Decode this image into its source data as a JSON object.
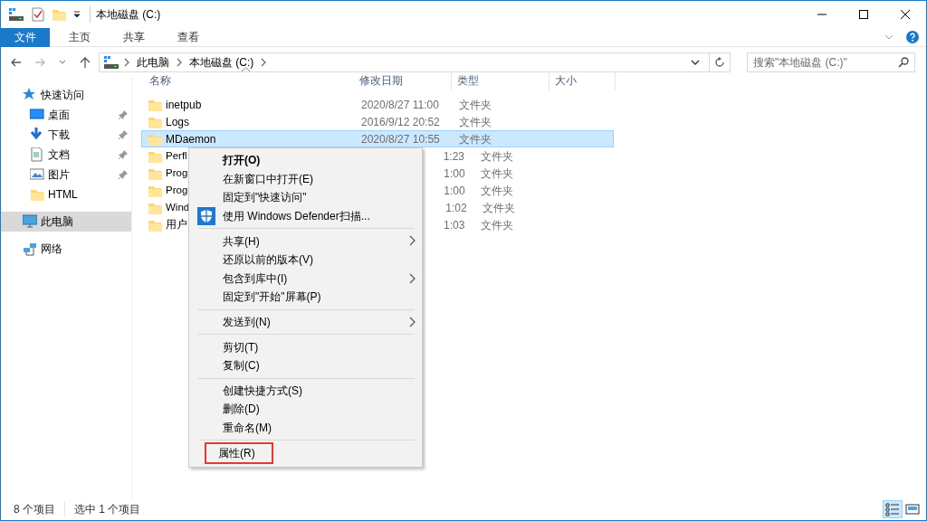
{
  "window": {
    "title": "本地磁盘 (C:)"
  },
  "ribbon_tabs": [
    {
      "label": "文件",
      "selected": true
    },
    {
      "label": "主页",
      "selected": false
    },
    {
      "label": "共享",
      "selected": false
    },
    {
      "label": "查看",
      "selected": false
    }
  ],
  "address": {
    "segments": [
      "此电脑",
      "本地磁盘 (C:)"
    ]
  },
  "search": {
    "placeholder": "搜索\"本地磁盘 (C:)\""
  },
  "sidebar": {
    "items": [
      {
        "label": "快速访问",
        "kind": "star",
        "selected": false,
        "children": [
          {
            "label": "桌面",
            "kind": "desktop",
            "pinned": true,
            "selected": false
          },
          {
            "label": "下載",
            "kind": "download",
            "pinned": true,
            "selected": false
          },
          {
            "label": "文档",
            "kind": "document",
            "pinned": true,
            "selected": false
          },
          {
            "label": "图片",
            "kind": "image",
            "pinned": true,
            "selected": false
          },
          {
            "label": "HTML",
            "kind": "folder",
            "pinned": false,
            "selected": false
          }
        ]
      },
      {
        "label": "此电脑",
        "kind": "computer",
        "selected": true
      },
      {
        "label": "网络",
        "kind": "network",
        "selected": false
      }
    ]
  },
  "table": {
    "columns": [
      "名称",
      "修改日期",
      "类型",
      "大小"
    ],
    "rows": [
      {
        "name": "inetpub",
        "date": "2020/8/27 11:00",
        "type": "文件夹",
        "selected": false
      },
      {
        "name": "Logs",
        "date": "2016/9/12 20:52",
        "type": "文件夹",
        "selected": false
      },
      {
        "name": "MDaemon",
        "date": "2020/8/27 10:55",
        "type": "文件夹",
        "selected": true
      },
      {
        "name": "Perfl",
        "date": "1:23",
        "type": "文件夹",
        "selected": false
      },
      {
        "name": "Prog",
        "date": "1:00",
        "type": "文件夹",
        "selected": false
      },
      {
        "name": "Prog",
        "date": "1:00",
        "type": "文件夹",
        "selected": false
      },
      {
        "name": "Wind",
        "date": "1:02",
        "type": "文件夹",
        "selected": false
      },
      {
        "name": "用户",
        "date": "1:03",
        "type": "文件夹",
        "selected": false
      }
    ]
  },
  "context_menu": {
    "items": [
      {
        "kind": "item",
        "label": "打开(O)",
        "default": true,
        "submenu": false,
        "highlighted": false
      },
      {
        "kind": "item",
        "label": "在新窗口中打开(E)",
        "default": false,
        "submenu": false,
        "highlighted": false
      },
      {
        "kind": "item",
        "label": "固定到\"快速访问\"",
        "default": false,
        "submenu": false,
        "highlighted": false
      },
      {
        "kind": "shield-item",
        "label": "使用 Windows Defender扫描...",
        "default": false,
        "submenu": false,
        "highlighted": false
      },
      {
        "kind": "separator"
      },
      {
        "kind": "item",
        "label": "共享(H)",
        "default": false,
        "submenu": true,
        "highlighted": false
      },
      {
        "kind": "item",
        "label": "还原以前的版本(V)",
        "default": false,
        "submenu": false,
        "highlighted": false
      },
      {
        "kind": "item",
        "label": "包含到库中(I)",
        "default": false,
        "submenu": true,
        "highlighted": false
      },
      {
        "kind": "item",
        "label": "固定到\"开始\"屏幕(P)",
        "default": false,
        "submenu": false,
        "highlighted": false
      },
      {
        "kind": "separator"
      },
      {
        "kind": "item",
        "label": "发送到(N)",
        "default": false,
        "submenu": true,
        "highlighted": false
      },
      {
        "kind": "separator"
      },
      {
        "kind": "item",
        "label": "剪切(T)",
        "default": false,
        "submenu": false,
        "highlighted": false
      },
      {
        "kind": "item",
        "label": "复制(C)",
        "default": false,
        "submenu": false,
        "highlighted": false
      },
      {
        "kind": "separator"
      },
      {
        "kind": "item",
        "label": "创建快捷方式(S)",
        "default": false,
        "submenu": false,
        "highlighted": false
      },
      {
        "kind": "item",
        "label": "删除(D)",
        "default": false,
        "submenu": false,
        "highlighted": false
      },
      {
        "kind": "item",
        "label": "重命名(M)",
        "default": false,
        "submenu": false,
        "highlighted": false
      },
      {
        "kind": "separator"
      },
      {
        "kind": "item",
        "label": "属性(R)",
        "default": false,
        "submenu": false,
        "highlighted": true
      }
    ]
  },
  "status_bar": {
    "items": [
      "8 个项目",
      "选中 1 个项目"
    ],
    "views": [
      {
        "kind": "details",
        "selected": true
      },
      {
        "kind": "thumbnails",
        "selected": false
      }
    ]
  }
}
